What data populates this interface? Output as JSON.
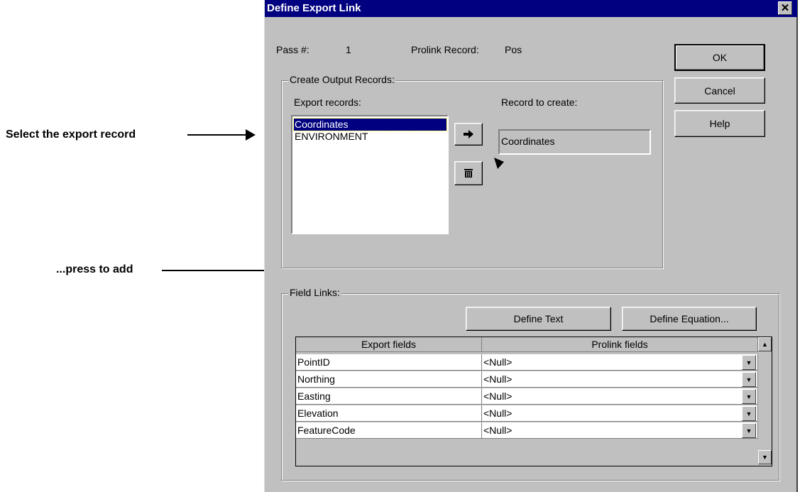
{
  "annotations": {
    "select_label": "Select the export record",
    "press_label": "...press to add"
  },
  "dialog": {
    "title": "Define Export Link",
    "close_glyph": "✕",
    "pass_label": "Pass #:",
    "pass_value": "1",
    "prolink_record_label": "Prolink Record:",
    "prolink_record_value": "Pos",
    "buttons": {
      "ok": "OK",
      "cancel": "Cancel",
      "help": "Help"
    },
    "output_group": {
      "title": "Create Output Records:",
      "export_records_label": "Export records:",
      "export_records": [
        "Coordinates",
        "ENVIRONMENT"
      ],
      "selected_record": "Coordinates",
      "record_to_create_label": "Record to create:",
      "record_to_create_value": "Coordinates",
      "add_icon": "right-arrow-icon",
      "delete_icon": "trash-icon"
    },
    "field_links": {
      "title": "Field Links:",
      "define_text_label": "Define Text",
      "define_equation_label": "Define Equation...",
      "columns": [
        "Export fields",
        "Prolink fields"
      ],
      "rows": [
        {
          "export": "PointID",
          "prolink": "<Null>"
        },
        {
          "export": "Northing",
          "prolink": "<Null>"
        },
        {
          "export": "Easting",
          "prolink": "<Null>"
        },
        {
          "export": "Elevation",
          "prolink": "<Null>"
        },
        {
          "export": "FeatureCode",
          "prolink": "<Null>"
        }
      ]
    }
  }
}
